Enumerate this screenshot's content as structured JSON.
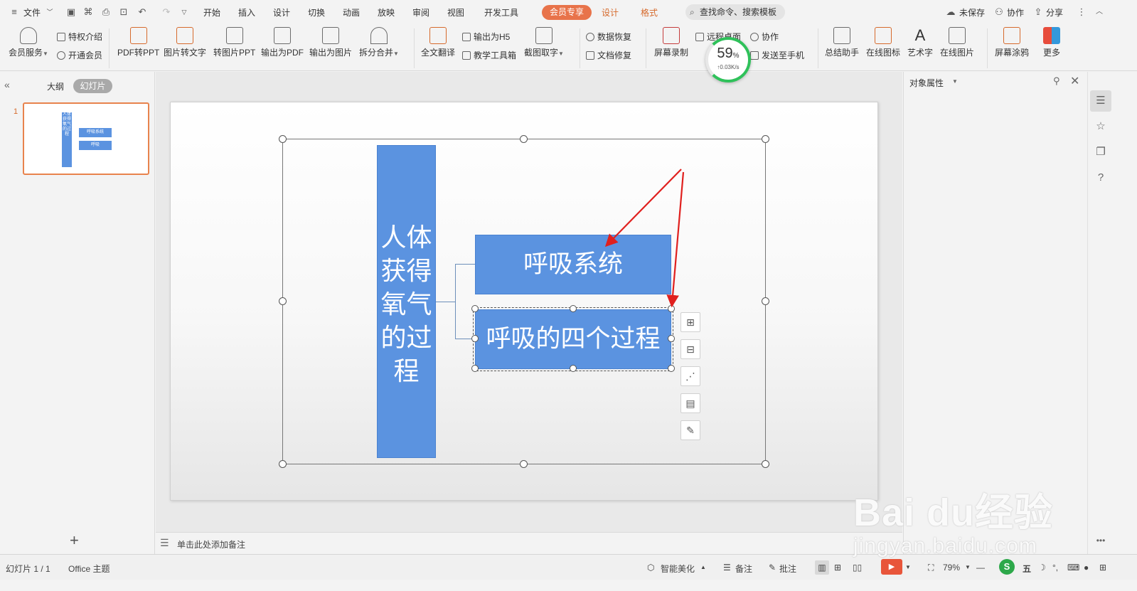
{
  "menubar": {
    "file_label": "文件",
    "tabs": [
      "开始",
      "插入",
      "设计",
      "切换",
      "动画",
      "放映",
      "审阅",
      "视图",
      "开发工具"
    ],
    "vip_tab": "会员专享",
    "context_tabs": [
      "设计",
      "格式"
    ],
    "search_placeholder": "查找命令、搜索模板",
    "right": {
      "unsaved": "未保存",
      "collab": "协作",
      "share": "分享"
    }
  },
  "ribbon": {
    "member_service": "会员服务",
    "privilege_intro": "特权介绍",
    "open_vip": "开通会员",
    "pdf_to_ppt": "PDF转PPT",
    "img_to_text": "图片转文字",
    "to_img_ppt": "转图片PPT",
    "export_pdf": "输出为PDF",
    "export_img": "输出为图片",
    "split_merge": "拆分合并",
    "full_translate": "全文翻译",
    "export_h5": "输出为H5",
    "teach_tools": "教学工具箱",
    "screenshot_text": "截图取字",
    "data_recover": "数据恢复",
    "doc_repair": "文档修复",
    "screen_record": "屏幕录制",
    "remote_desktop": "远程桌面",
    "collab": "协作",
    "send_to_phone": "发送至手机",
    "summary_helper": "总结助手",
    "online_icons": "在线图标",
    "art_text": "艺术字",
    "online_images": "在线图片",
    "screen_draw": "屏幕涂鸦",
    "more": "更多"
  },
  "gauge": {
    "percent": "59",
    "percent_sign": "%",
    "speed": "↑0.03K/s"
  },
  "left_panel": {
    "tab_outline": "大纲",
    "tab_slides": "幻灯片",
    "slide_number": "1",
    "add_slide": "+"
  },
  "slide": {
    "vertical_text": "人体获得氧气的过程",
    "box1": "呼吸系统",
    "box2": "呼吸的四个过程",
    "thumb_vertical": "人体获得氧气的过程",
    "thumb_box1": "呼吸系统",
    "thumb_box2": "呼吸"
  },
  "right_panel": {
    "title": "对象属性"
  },
  "notes": {
    "placeholder": "单击此处添加备注"
  },
  "statusbar": {
    "slide_counter": "幻灯片 1 / 1",
    "theme": "Office 主题",
    "smart_beautify": "智能美化",
    "notes": "备注",
    "comments": "批注",
    "zoom": "79%"
  },
  "watermark": {
    "logo": "Bai du经验",
    "url": "jingyan.baidu.com"
  },
  "colors": {
    "shape_blue": "#5b93e0",
    "accent_orange": "#e8734a",
    "arrow_red": "#e0201e",
    "gauge_green": "#2fc15a"
  }
}
